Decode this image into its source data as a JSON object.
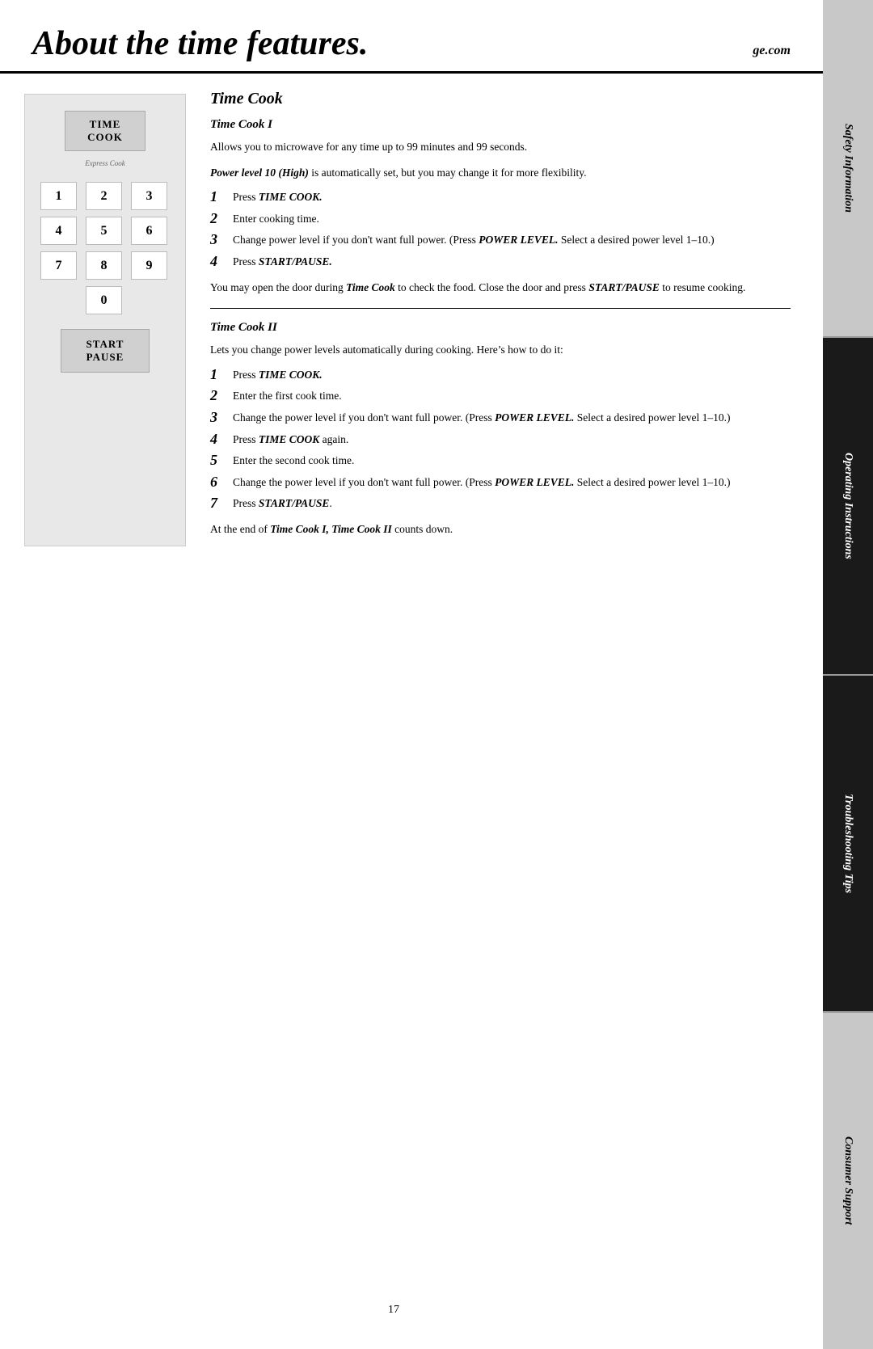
{
  "header": {
    "title": "About the time features.",
    "website": "ge.com"
  },
  "sidebar": {
    "sections": [
      {
        "label": "Safety Information",
        "style": "gray-bg"
      },
      {
        "label": "Operating Instructions",
        "style": "black-bg"
      },
      {
        "label": "Troubleshooting Tips",
        "style": "black-bg"
      },
      {
        "label": "Consumer Support",
        "style": "gray-bg"
      }
    ]
  },
  "keypad": {
    "time_cook_line1": "Time",
    "time_cook_line2": "Cook",
    "express_cook_label": "Express Cook",
    "keys": [
      "1",
      "2",
      "3",
      "4",
      "5",
      "6",
      "7",
      "8",
      "9",
      "0"
    ],
    "start_line1": "Start",
    "start_line2": "Pause"
  },
  "content": {
    "main_section_title": "Time Cook",
    "time_cook_i": {
      "subtitle": "Time Cook I",
      "intro": "Allows you to microwave for any time up to 99 minutes and 99 seconds.",
      "power_level_note": "Power level 10 (High) is automatically set, but you may change it for more flexibility.",
      "steps": [
        {
          "num": "1",
          "text": "Press TIME COOK."
        },
        {
          "num": "2",
          "text": "Enter cooking time."
        },
        {
          "num": "3",
          "text": "Change power level if you don’t want full power. (Press POWER LEVEL. Select a desired power level 1–10.)"
        },
        {
          "num": "4",
          "text": "Press START/PAUSE."
        }
      ],
      "note": "You may open the door during Time Cook to check the food. Close the door and press START/PAUSE to resume cooking."
    },
    "time_cook_ii": {
      "subtitle": "Time Cook II",
      "intro": "Lets you change power levels automatically during cooking. Here’s how to do it:",
      "steps": [
        {
          "num": "1",
          "text": "Press TIME COOK."
        },
        {
          "num": "2",
          "text": "Enter the first cook time."
        },
        {
          "num": "3",
          "text": "Change the power level if you don’t want full power. (Press POWER LEVEL. Select a desired power level 1–10.)"
        },
        {
          "num": "4",
          "text": "Press TIME COOK again."
        },
        {
          "num": "5",
          "text": "Enter the second cook time."
        },
        {
          "num": "6",
          "text": "Change the power level if you don’t want full power. (Press POWER LEVEL. Select a desired power level 1–10.)"
        },
        {
          "num": "7",
          "text": "Press START/PAUSE."
        }
      ],
      "footer_note": "At the end of Time Cook I, Time Cook II counts down."
    }
  },
  "page_number": "17"
}
